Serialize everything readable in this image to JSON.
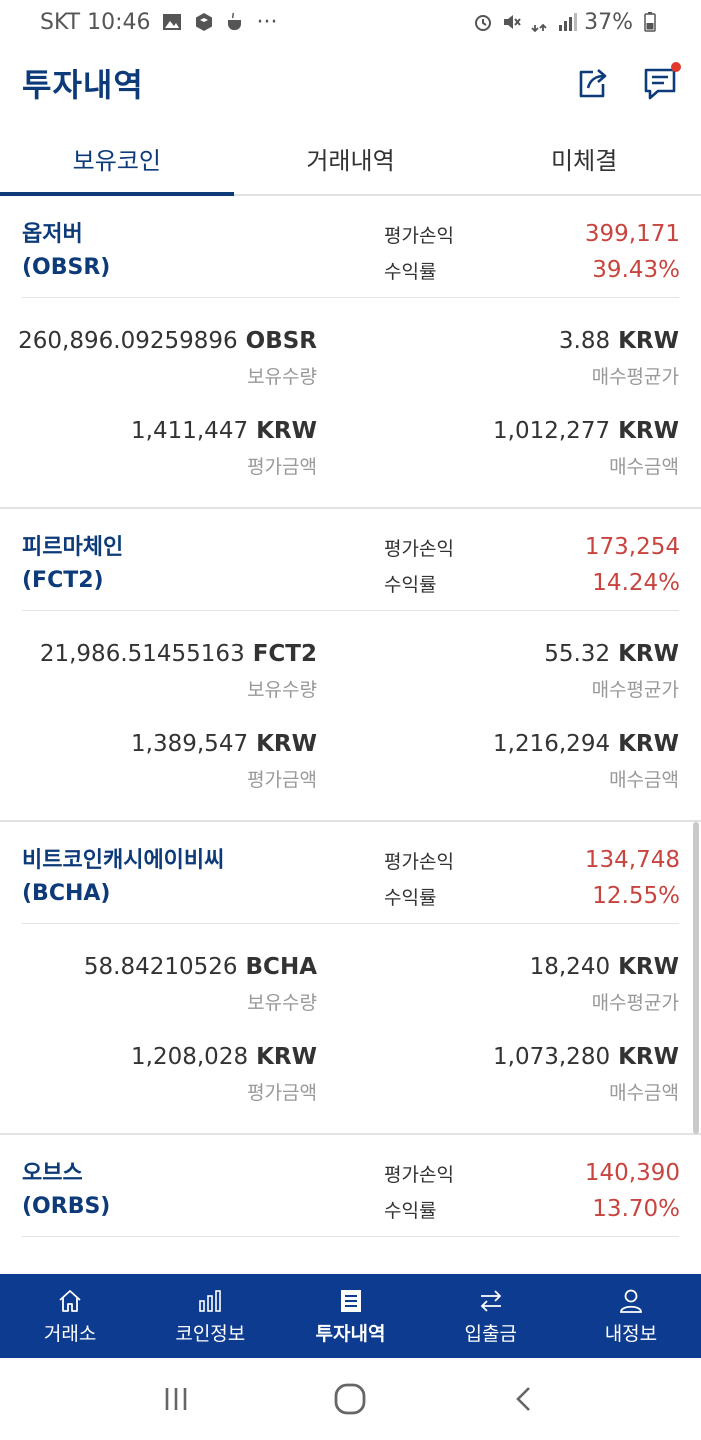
{
  "status": {
    "carrier_time": "SKT 10:46",
    "more": "···",
    "battery": "37%"
  },
  "header": {
    "title": "투자내역"
  },
  "tabs": [
    {
      "label": "보유코인",
      "active": true
    },
    {
      "label": "거래내역",
      "active": false
    },
    {
      "label": "미체결",
      "active": false
    }
  ],
  "labels": {
    "pl": "평가손익",
    "rate": "수익률",
    "holding": "보유수량",
    "avg_price": "매수평균가",
    "eval_amount": "평가금액",
    "buy_amount": "매수금액",
    "krw": "KRW"
  },
  "coins": [
    {
      "name": "옵저버",
      "symbol": "(OBSR)",
      "pl": "399,171",
      "rate": "39.43%",
      "holding": "260,896.09259896",
      "unit": "OBSR",
      "avg_price": "3.88",
      "eval_amount": "1,411,447",
      "buy_amount": "1,012,277"
    },
    {
      "name": "피르마체인",
      "symbol": "(FCT2)",
      "pl": "173,254",
      "rate": "14.24%",
      "holding": "21,986.51455163",
      "unit": "FCT2",
      "avg_price": "55.32",
      "eval_amount": "1,389,547",
      "buy_amount": "1,216,294"
    },
    {
      "name": "비트코인캐시에이비씨",
      "symbol": "(BCHA)",
      "pl": "134,748",
      "rate": "12.55%",
      "holding": "58.84210526",
      "unit": "BCHA",
      "avg_price": "18,240",
      "eval_amount": "1,208,028",
      "buy_amount": "1,073,280"
    },
    {
      "name": "오브스",
      "symbol": "(ORBS)",
      "pl": "140,390",
      "rate": "13.70%"
    }
  ],
  "bottom_nav": [
    {
      "label": "거래소",
      "icon": "home-icon"
    },
    {
      "label": "코인정보",
      "icon": "bar-chart-icon"
    },
    {
      "label": "투자내역",
      "icon": "document-icon",
      "active": true
    },
    {
      "label": "입출금",
      "icon": "transfer-icon"
    },
    {
      "label": "내정보",
      "icon": "user-icon"
    }
  ],
  "colors": {
    "brand": "#0d3b7a",
    "nav_bg": "#0d3b8f",
    "profit": "#c8453f"
  }
}
